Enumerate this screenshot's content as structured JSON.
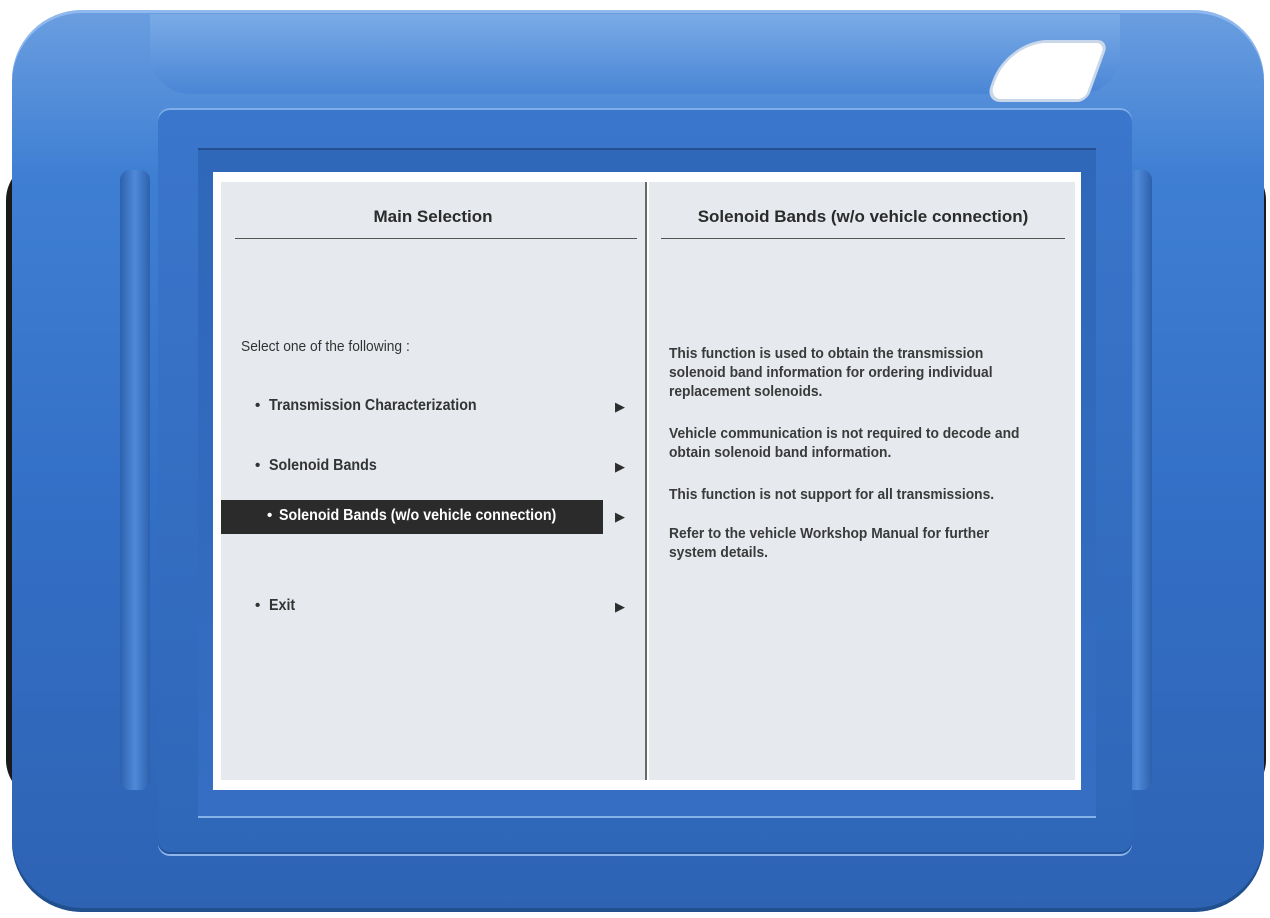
{
  "left_panel": {
    "title": "Main Selection",
    "prompt": "Select one of the following :",
    "items": [
      {
        "label": "Transmission Characterization",
        "arrow": "▶",
        "selected": false
      },
      {
        "label": "Solenoid Bands",
        "arrow": "▶",
        "selected": false
      },
      {
        "label": "Solenoid Bands (w/o vehicle connection)",
        "arrow": "▶",
        "selected": true
      },
      {
        "label": "Exit",
        "arrow": "▶",
        "selected": false
      }
    ]
  },
  "right_panel": {
    "title": "Solenoid Bands (w/o vehicle connection)",
    "paragraphs": [
      "This function is used to obtain the transmission solenoid band information for ordering individual replacement solenoids.",
      "Vehicle communication is not required to decode and obtain solenoid band information.",
      "This function is not support for all transmissions.",
      "Refer to the vehicle Workshop Manual for further system details."
    ]
  },
  "colors": {
    "casing_blue": "#3a76cc",
    "grip_black": "#1a1a1b",
    "panel_bg": "#e6eaee",
    "selection_bg": "#2b2b2b"
  },
  "icons": {
    "item_bullet": "bullet-icon",
    "item_arrow": "play-arrow-icon"
  }
}
